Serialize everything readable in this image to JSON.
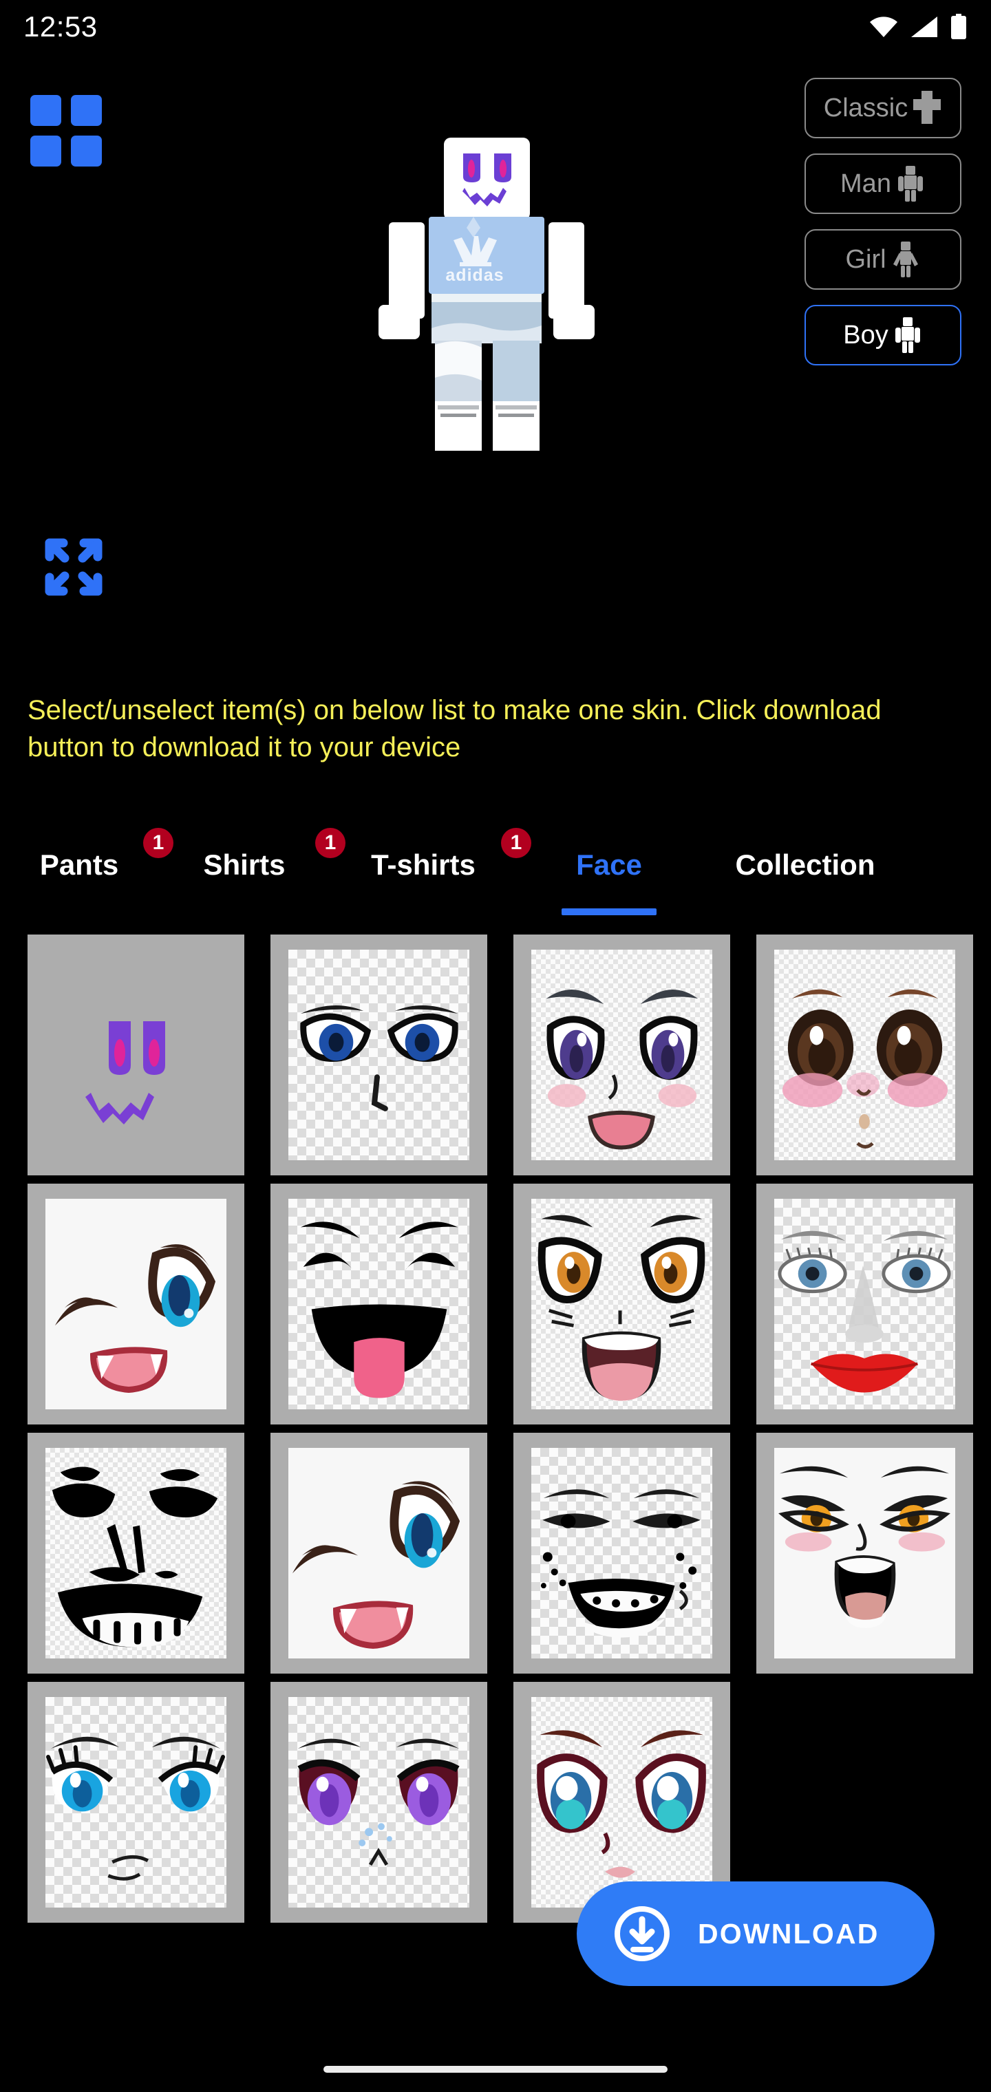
{
  "status_bar": {
    "time": "12:53",
    "icons": [
      "wifi-icon",
      "cellular-signal-icon",
      "battery-icon"
    ]
  },
  "header": {
    "grid_icon": "grid-menu-icon",
    "expand_icon": "fullscreen-expand-icon"
  },
  "avatar": {
    "name": "roblox-avatar-preview",
    "body_color": "#ffffff",
    "face_color": "#6b3fd4",
    "shirt_color": "#a8c8ee",
    "shirt_brand": "adidas",
    "pants_color": "#b9cbdc"
  },
  "type_buttons": [
    {
      "label": "Classic",
      "icon": "classic-figure-icon",
      "active": false
    },
    {
      "label": "Man",
      "icon": "man-figure-icon",
      "active": false
    },
    {
      "label": "Girl",
      "icon": "girl-figure-icon",
      "active": false
    },
    {
      "label": "Boy",
      "icon": "boy-figure-icon",
      "active": true
    }
  ],
  "instruction": "Select/unselect item(s) on below list to make one skin. Click download button to download it to your device",
  "instruction_color": "#f5ef58",
  "tabs": [
    {
      "label": "Pants",
      "badge": "1",
      "active": false
    },
    {
      "label": "Shirts",
      "badge": "1",
      "active": false
    },
    {
      "label": "T-shirts",
      "badge": "1",
      "active": false
    },
    {
      "label": "Face",
      "badge": "",
      "active": true
    },
    {
      "label": "Collection",
      "badge": "",
      "active": false
    }
  ],
  "accent_color": "#2f72f7",
  "badge_color": "#b2001f",
  "face_items": [
    {
      "name": "purple-classic-face",
      "style": "selected",
      "selected": true
    },
    {
      "name": "anime-blue-eyes-sharp-face",
      "style": "checker",
      "selected": false
    },
    {
      "name": "anime-purple-eyes-smile-face",
      "style": "checker-fine",
      "selected": false
    },
    {
      "name": "anime-brown-eyes-blush-face",
      "style": "checker-fine",
      "selected": false
    },
    {
      "name": "wink-blue-eye-fang-face",
      "style": "plainwhite",
      "selected": false
    },
    {
      "name": "happy-tongue-out-face",
      "style": "checker",
      "selected": false
    },
    {
      "name": "surprised-orange-eyes-face",
      "style": "checker-fine",
      "selected": false
    },
    {
      "name": "realistic-red-lips-face",
      "style": "checker",
      "selected": false
    },
    {
      "name": "black-ink-grin-face",
      "style": "checker-fine",
      "selected": false
    },
    {
      "name": "wink-blue-eye-fang-face-2",
      "style": "plainwhite",
      "selected": false
    },
    {
      "name": "braces-smile-freckles-face",
      "style": "checker",
      "selected": false
    },
    {
      "name": "orange-eyes-open-mouth-face",
      "style": "plainwhite",
      "selected": false
    },
    {
      "name": "blue-eyes-lashes-face",
      "style": "checker",
      "selected": false
    },
    {
      "name": "purple-eyes-tears-face",
      "style": "checker",
      "selected": false
    },
    {
      "name": "teal-eyes-blush-face",
      "style": "checker-fine",
      "selected": false
    }
  ],
  "download": {
    "label": "DOWNLOAD",
    "icon": "download-circle-icon",
    "color": "#2f7cf6"
  }
}
